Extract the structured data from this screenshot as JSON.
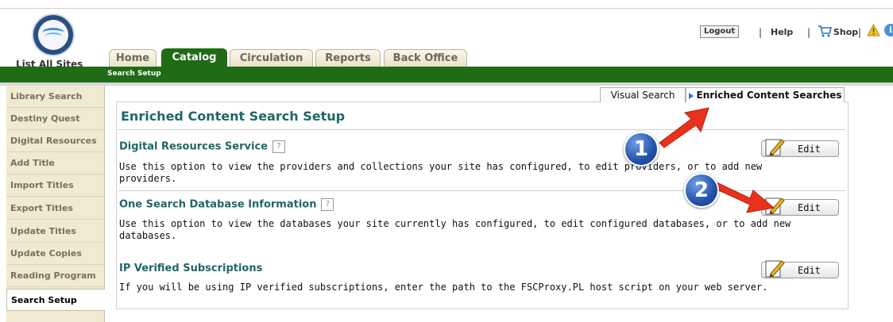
{
  "header": {
    "site_link": "List All Sites",
    "logout": "Logout",
    "help": "Help",
    "shop": "Shop",
    "separator": "|",
    "info": "i"
  },
  "tabs": [
    "Home",
    "Catalog",
    "Circulation",
    "Reports",
    "Back Office"
  ],
  "active_tab": "Catalog",
  "subnav": "Search Setup",
  "sidebar": {
    "items": [
      "Library Search",
      "Destiny Quest",
      "Digital Resources",
      "Add Title",
      "Import Titles",
      "Export Titles",
      "Update Titles",
      "Update Copies",
      "Reading Program",
      "Search Setup"
    ],
    "active": "Search Setup"
  },
  "subtabs": [
    "Visual Search",
    "Enriched Content Searches"
  ],
  "page_title": "Enriched Content Search Setup",
  "sections": [
    {
      "title": "Digital Resources Service",
      "help": "?",
      "desc": "Use this option to view the providers and collections your site has configured, to edit providers, or to add new providers.",
      "button": "Edit"
    },
    {
      "title": "One Search Database Information",
      "help": "?",
      "desc": "Use this option to view the databases your site currently has configured, to edit configured databases, or to add new databases.",
      "button": "Edit"
    },
    {
      "title": "IP Verified Subscriptions",
      "desc": "If you will be using IP verified subscriptions, enter the path to the FSCProxy.PL host script on your web server.",
      "button": "Edit"
    }
  ],
  "callouts": [
    "1",
    "2"
  ],
  "colors": {
    "brand_green": "#1f6b16",
    "title_teal": "#1f6766",
    "sidebar_bg": "#f1ead2",
    "arrow_red": "#e8321c",
    "badge_blue": "#2451a8"
  }
}
